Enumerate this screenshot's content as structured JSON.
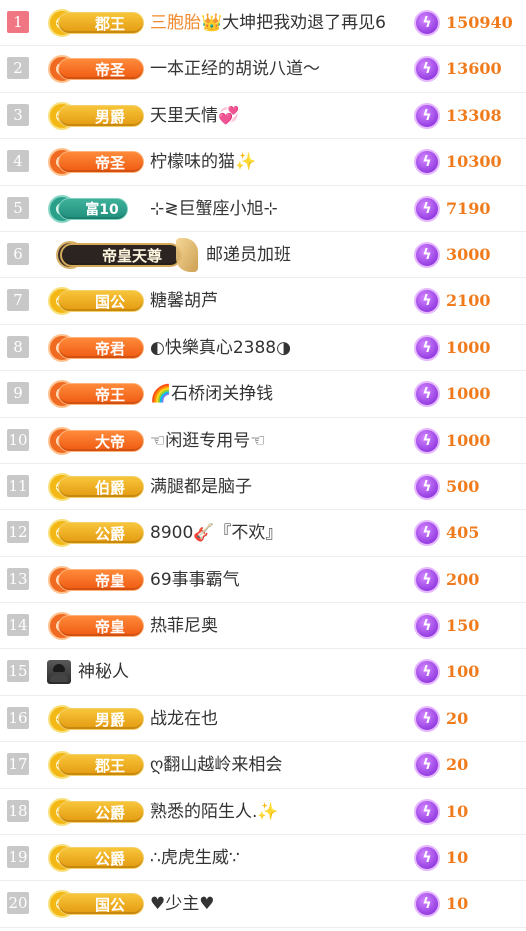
{
  "icons": {
    "bolt": "lightning-bolt-icon"
  },
  "colors": {
    "rank_first": "#f07683",
    "rank_default": "#c8c8c8",
    "score": "#f07b1c",
    "highlight_name": "#f28a2e"
  },
  "rows": [
    {
      "rank": "1",
      "badge": "郡王",
      "badge_style": "gold",
      "name_prefix": "三胞胎",
      "crown": "👑",
      "name": "大坤把我劝退了再见6",
      "score": "150940"
    },
    {
      "rank": "2",
      "badge": "帝圣",
      "badge_style": "orange",
      "name": "一本正经的胡说八道～",
      "score": "13600"
    },
    {
      "rank": "3",
      "badge": "男爵",
      "badge_style": "gold",
      "name": "天里夭情💞",
      "score": "13308"
    },
    {
      "rank": "4",
      "badge": "帝圣",
      "badge_style": "orange",
      "name": "柠檬味的猫✨",
      "score": "10300"
    },
    {
      "rank": "5",
      "badge": "富10",
      "badge_style": "teal",
      "name": "⊹≷巨蟹座小旭⊹",
      "score": "7190"
    },
    {
      "rank": "6",
      "badge": "帝皇天尊",
      "badge_style": "emperor",
      "name": "邮递员加班",
      "score": "3000"
    },
    {
      "rank": "7",
      "badge": "国公",
      "badge_style": "gold",
      "name": "糖馨胡芦",
      "score": "2100"
    },
    {
      "rank": "8",
      "badge": "帝君",
      "badge_style": "orange",
      "name": "◐快樂真心2388◑",
      "score": "1000"
    },
    {
      "rank": "9",
      "badge": "帝王",
      "badge_style": "orange",
      "name": "🌈石桥闭关挣钱",
      "score": "1000"
    },
    {
      "rank": "10",
      "badge": "大帝",
      "badge_style": "orange",
      "name": "☜闲逛专用号☜",
      "score": "1000"
    },
    {
      "rank": "11",
      "badge": "伯爵",
      "badge_style": "gold",
      "name": "满腿都是脑子",
      "score": "500"
    },
    {
      "rank": "12",
      "badge": "公爵",
      "badge_style": "gold",
      "name": "8900🎸『不欢』",
      "score": "405"
    },
    {
      "rank": "13",
      "badge": "帝皇",
      "badge_style": "orange",
      "name": "69事事霸气",
      "score": "200"
    },
    {
      "rank": "14",
      "badge": "帝皇",
      "badge_style": "orange",
      "name": "热菲尼奥",
      "score": "150"
    },
    {
      "rank": "15",
      "badge": "",
      "badge_style": "none",
      "name": "神秘人",
      "score": "100"
    },
    {
      "rank": "16",
      "badge": "男爵",
      "badge_style": "gold",
      "name": "战龙在也",
      "score": "20"
    },
    {
      "rank": "17",
      "badge": "郡王",
      "badge_style": "gold",
      "name": "ღ翻山越岭来相会",
      "score": "20"
    },
    {
      "rank": "18",
      "badge": "公爵",
      "badge_style": "gold",
      "name": "熟悉的陌生人.✨",
      "score": "10"
    },
    {
      "rank": "19",
      "badge": "公爵",
      "badge_style": "gold",
      "name": "∴虎虎生威∵",
      "score": "10"
    },
    {
      "rank": "20",
      "badge": "国公",
      "badge_style": "gold",
      "name": "♥少主♥",
      "score": "10"
    }
  ]
}
